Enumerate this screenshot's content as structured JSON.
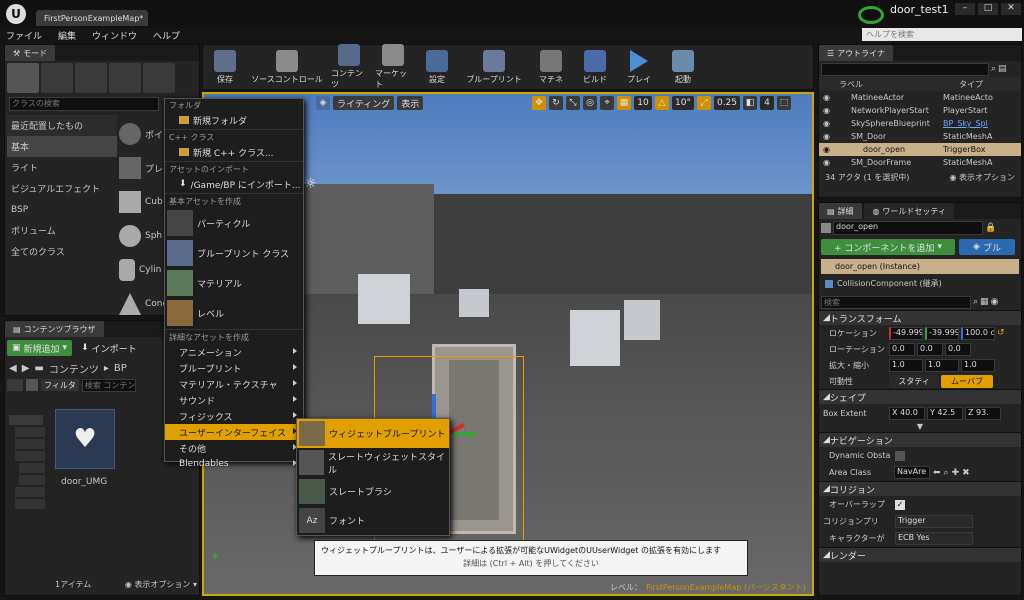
{
  "window": {
    "tab_title": "FirstPersonExampleMap*",
    "project_name": "door_test1",
    "help_search_placeholder": "ヘルプを検索"
  },
  "menubar": [
    "ファイル",
    "編集",
    "ウィンドウ",
    "ヘルプ"
  ],
  "modes": {
    "tab_label": "モード",
    "search_placeholder": "クラスの検索",
    "categories": [
      "最近配置したもの",
      "基本",
      "ライト",
      "ビジュアルエフェクト",
      "BSP",
      "ボリューム",
      "全てのクラス"
    ],
    "items": [
      "ポイ",
      "プレ",
      "Cub",
      "Sph",
      "Cylin",
      "Cone"
    ]
  },
  "toolbar": {
    "items": [
      "保存",
      "ソースコントロール",
      "コンテンツ",
      "マーケット",
      "設定",
      "ブループリント",
      "マチネ",
      "ビルド",
      "プレイ",
      "起動"
    ]
  },
  "viewport": {
    "buttons": [
      "ライティング",
      "表示"
    ],
    "grid_value": "10",
    "rot_value": "10°",
    "scale_value": "0.25",
    "cam_value": "4",
    "level_label": "レベル：",
    "level_name": "FirstPersonExampleMap (パーシスタント)"
  },
  "context_menu": {
    "folder_header": "フォルダ",
    "new_folder": "新規フォルダ",
    "cpp_header": "C++ クラス",
    "new_cpp": "新規 C++ クラス...",
    "import_header": "アセットのインポート",
    "import_to": "/Game/BP にインポート...",
    "basic_header": "基本アセットを作成",
    "basic_items": [
      "パーティクル",
      "ブループリント クラス",
      "マテリアル",
      "レベル"
    ],
    "advanced_header": "詳細なアセットを作成",
    "advanced_items": [
      "アニメーション",
      "ブループリント",
      "マテリアル・テクスチャ",
      "サウンド",
      "フィジックス",
      "ユーザーインターフェイス",
      "その他",
      "Blendables"
    ]
  },
  "submenu": {
    "items": [
      "ウィジェットブループリント",
      "スレートウィジェットスタイル",
      "スレートブラシ",
      "フォント"
    ]
  },
  "tooltip": {
    "line1": "ウィジェットブループリントは、ユーザーによる拡張が可能なUWidgetのUUserWidget の拡張を有効にします",
    "line2": "詳細は (Ctrl + Alt) を押してください"
  },
  "content_browser": {
    "tab_label": "コンテンツブラウザ",
    "add_new": "新規追加",
    "import": "インポート",
    "path": [
      "コンテンツ",
      "BP"
    ],
    "filter": "フィルタ",
    "search_placeholder": "検索 コンテン",
    "asset_name": "door_UMG",
    "item_count": "1アイテム",
    "view_options": "表示オプション"
  },
  "outliner": {
    "tab_label": "アウトライナ",
    "col_label": "ラベル",
    "col_type": "タイプ",
    "rows": [
      {
        "label": "MatineeActor",
        "type": "MatineeActo"
      },
      {
        "label": "NetworkPlayerStart",
        "type": "PlayerStart"
      },
      {
        "label": "SkySphereBlueprint",
        "type": "BP_Sky_Spl"
      },
      {
        "label": "SM_Door",
        "type": "StaticMeshA"
      },
      {
        "label": "door_open",
        "type": "TriggerBox"
      },
      {
        "label": "SM_DoorFrame",
        "type": "StaticMeshA"
      }
    ],
    "footer": "34 アクタ (1 を選択中)",
    "view_options": "表示オプション"
  },
  "details": {
    "tab_label": "詳細",
    "world_tab": "ワールドセッティ",
    "actor_name": "door_open",
    "add_component": "+ コンポーネントを追加",
    "blueprint_btn": "ブル",
    "instance": "door_open (Instance)",
    "component": "CollisionComponent (継承)",
    "search_placeholder": "検索",
    "transform": {
      "header": "トランスフォーム",
      "location": "ロケーション",
      "rotation": "ローテーション",
      "scale": "拡大・縮小",
      "mobility": "可動性",
      "loc": [
        "-49.999",
        "-39.999",
        "100.0 c"
      ],
      "rot": [
        "0.0",
        "0.0",
        "0.0"
      ],
      "scl": [
        "1.0",
        "1.0",
        "1.0"
      ],
      "static": "スタティ",
      "movable": "ムーバブ"
    },
    "shape": {
      "header": "シェイプ",
      "box_extent": "Box Extent",
      "x": "X 40.0",
      "y": "Y 42.5",
      "z": "Z 93."
    },
    "nav": {
      "header": "ナビゲーション",
      "dynamic": "Dynamic Obsta",
      "area": "Area Class",
      "area_val": "NavAre"
    },
    "collision": {
      "header": "コリジョン",
      "overlap": "オーバーラップ",
      "preset": "コリジョンプリ",
      "preset_val": "Trigger",
      "char": "キャラクターが",
      "char_val": "ECB Yes"
    },
    "render_header": "レンダー"
  }
}
